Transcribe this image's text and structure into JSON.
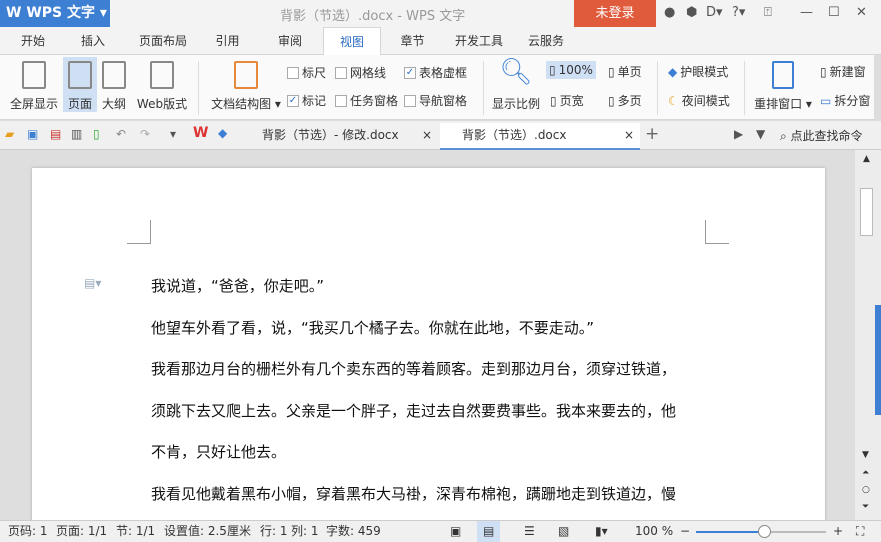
{
  "app": {
    "logo": "W WPS 文字 ▾",
    "title": "背影（节选）.docx - WPS 文字",
    "login": "未登录"
  },
  "menu_tabs": [
    "开始",
    "插入",
    "页面布局",
    "引用",
    "审阅",
    "视图",
    "章节",
    "开发工具",
    "云服务"
  ],
  "active_tab": "视图",
  "ribbon": {
    "fullscreen": "全屏显示",
    "page": "页面",
    "outline": "大纲",
    "web": "Web版式",
    "docmap": "文档结构图 ▾",
    "ruler": "标尺",
    "grid": "网格线",
    "table_grid": "表格虚框",
    "mark": "标记",
    "task_pane": "任务窗格",
    "nav_pane": "导航窗格",
    "zoom_ratio": "显示比例",
    "zoom100": "100%",
    "page_width": "页宽",
    "single": "单页",
    "multi": "多页",
    "eye_mode": "护眼模式",
    "night_mode": "夜间模式",
    "arrange": "重排窗口 ▾",
    "new_window": "新建窗",
    "split": "拆分窗"
  },
  "doc_tabs": [
    "背影（节选）- 修改.docx",
    "背影（节选）.docx"
  ],
  "search_command": "点此查找命令",
  "document": {
    "lines": [
      "我说道，“爸爸，你走吧。”",
      "他望车外看了看，说，“我买几个橘子去。你就在此地，不要走动。”",
      "我看那边月台的栅栏外有几个卖东西的等着顾客。走到那边月台，须穿过铁道，",
      "须跳下去又爬上去。父亲是一个胖子，走过去自然要费事些。我本来要去的，他",
      "不肯，只好让他去。",
      "我看见他戴着黑布小帽，穿着黑布大马褂，深青布棉袍，蹒跚地走到铁道边，慢"
    ]
  },
  "status": {
    "page": "页码: 1",
    "pages": "页面: 1/1",
    "section": "节: 1/1",
    "setting": "设置值: 2.5厘米",
    "row": "行: 1",
    "col": "列: 1",
    "words": "字数: 459",
    "zoom": "100 %"
  },
  "zoom_percent": 100
}
